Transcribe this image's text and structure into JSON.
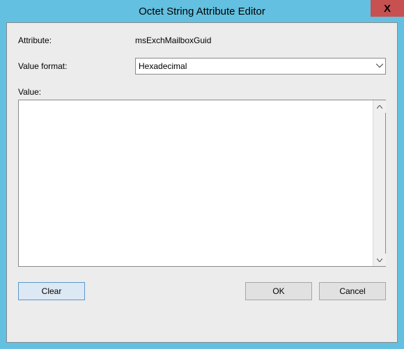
{
  "window": {
    "title": "Octet String Attribute Editor",
    "close_label": "X"
  },
  "attribute": {
    "label": "Attribute:",
    "name": "msExchMailboxGuid"
  },
  "value_format": {
    "label": "Value format:",
    "selected": "Hexadecimal"
  },
  "value": {
    "label": "Value:",
    "text": ""
  },
  "buttons": {
    "clear": "Clear",
    "ok": "OK",
    "cancel": "Cancel"
  }
}
